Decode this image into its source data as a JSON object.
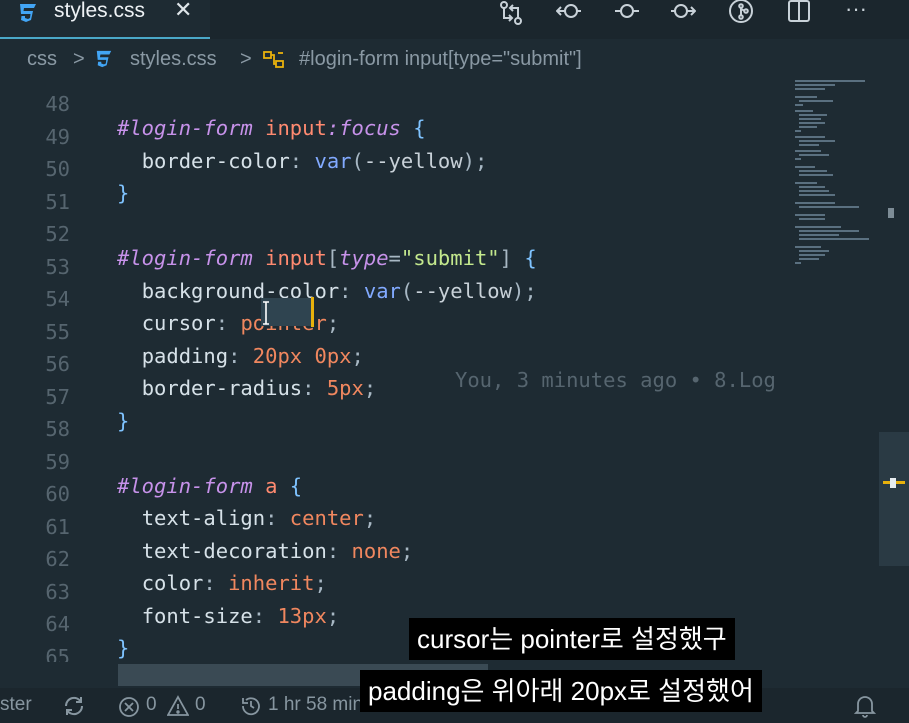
{
  "tab": {
    "label": "styles.css",
    "close": "✕"
  },
  "toolbar": {
    "icons": [
      "source-control-compare-icon",
      "go-back-commit-icon",
      "commit-icon",
      "go-forward-commit-icon",
      "git-history-icon",
      "split-editor-icon",
      "more-actions-icon"
    ],
    "more": "···"
  },
  "breadcrumb": {
    "folder": "css",
    "sep1": ">",
    "file": "styles.css",
    "sep2": ">",
    "symbol": "#login-form input[type=\"submit\"]"
  },
  "editor": {
    "lines": [
      {
        "num": "48",
        "text": "#login-form input:focus {"
      },
      {
        "num": "49",
        "text": "  border-color: var(--yellow);"
      },
      {
        "num": "50",
        "text": "}"
      },
      {
        "num": "51",
        "text": ""
      },
      {
        "num": "52",
        "text": "#login-form input[type=\"submit\"] {"
      },
      {
        "num": "53",
        "text": "  background-color: var(--yellow);"
      },
      {
        "num": "54",
        "text": "  cursor: pointer;"
      },
      {
        "num": "55",
        "text": "  padding: 20px 0px;"
      },
      {
        "num": "56",
        "text": "  border-radius: 5px;"
      },
      {
        "num": "57",
        "text": "}"
      },
      {
        "num": "58",
        "text": ""
      },
      {
        "num": "59",
        "text": "#login-form a {"
      },
      {
        "num": "60",
        "text": "  text-align: center;"
      },
      {
        "num": "61",
        "text": "  text-decoration: none;"
      },
      {
        "num": "62",
        "text": "  color: inherit;"
      },
      {
        "num": "63",
        "text": "  font-size: 13px;"
      },
      {
        "num": "64",
        "text": "}"
      },
      {
        "num": "65",
        "text": ""
      }
    ],
    "blame": "You, 3 minutes ago • 8.Log"
  },
  "statusbar": {
    "branch": "ster",
    "errors": "0",
    "warnings": "0",
    "time": "1 hr 58 min"
  },
  "subtitles": {
    "line1": "cursor는 pointer로 설정했구",
    "line2": "padding은 위아래 20px로 설정했어"
  },
  "colors": {
    "background": "#1e2b33",
    "accent": "#e8b10c",
    "css_icon": "#42a5f5"
  }
}
